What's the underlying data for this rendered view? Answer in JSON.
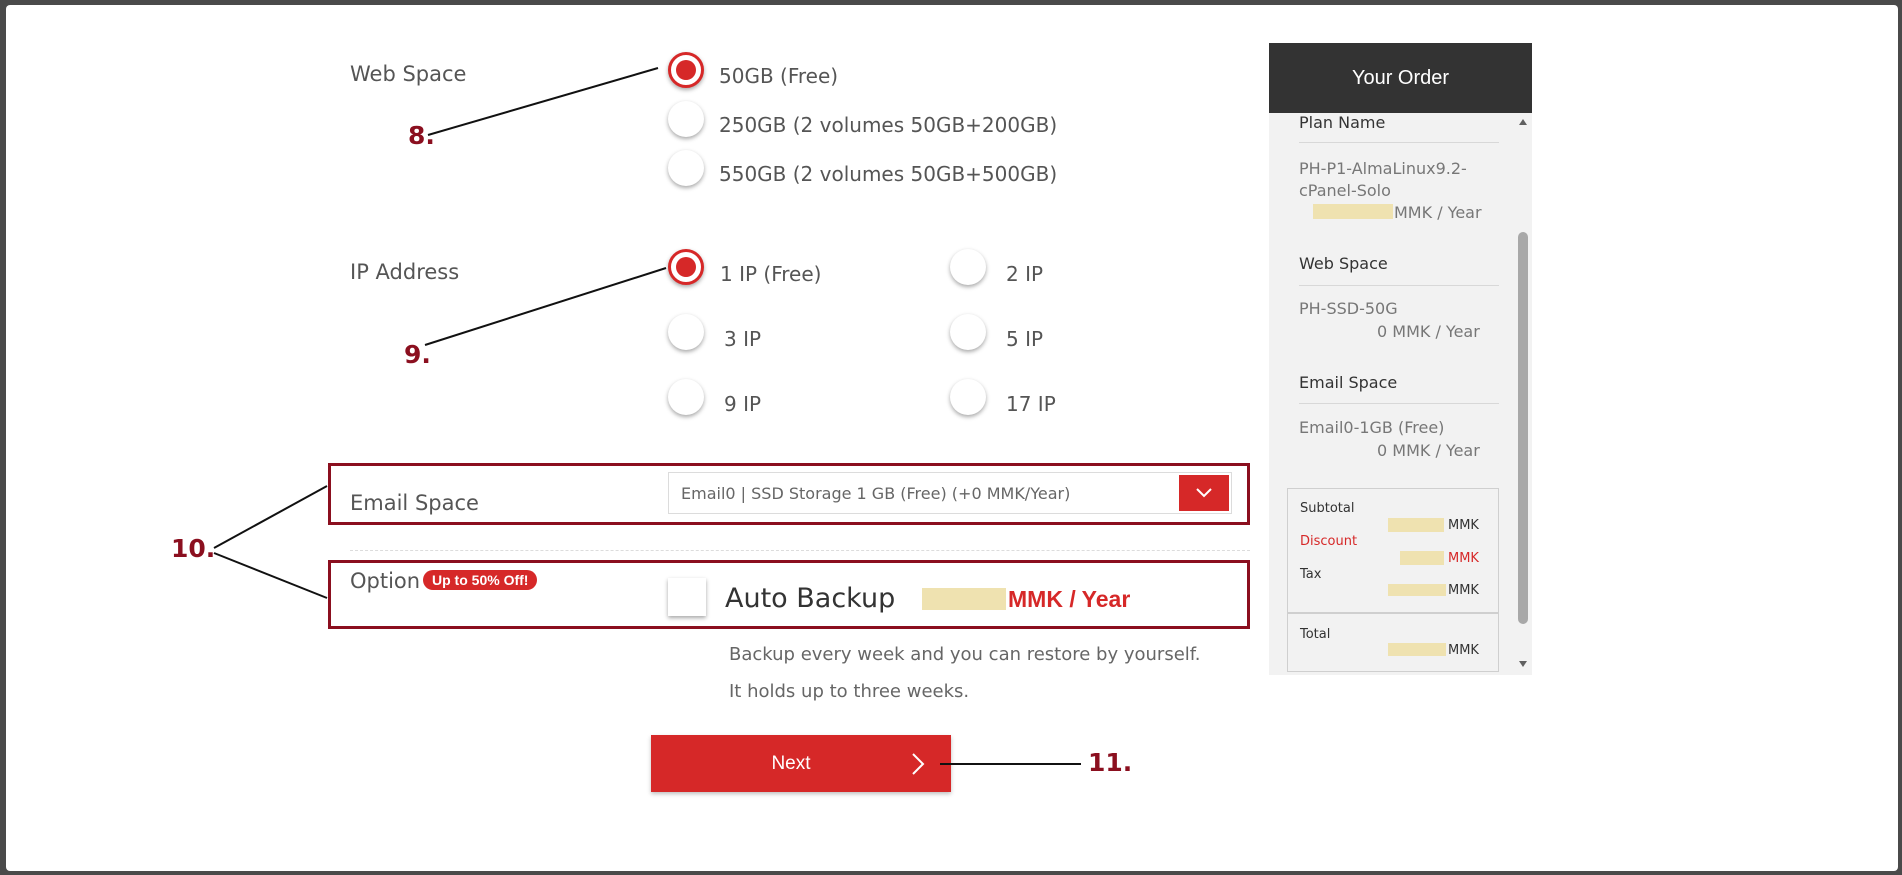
{
  "web_space": {
    "label": "Web Space",
    "options": [
      "50GB (Free)",
      "250GB (2 volumes 50GB+200GB)",
      "550GB (2 volumes 50GB+500GB)"
    ],
    "selected": "50GB (Free)"
  },
  "ip_address": {
    "label": "IP Address",
    "options": [
      "1 IP (Free)",
      "2 IP",
      "3 IP",
      "5 IP",
      "9 IP",
      "17 IP"
    ],
    "selected": "1 IP (Free)"
  },
  "email_space": {
    "label": "Email Space",
    "selected": "Email0 | SSD Storage 1 GB (Free) (+0 MMK/Year)"
  },
  "option": {
    "label": "Option",
    "badge": "Up to 50% Off!",
    "auto_backup": "Auto Backup",
    "price_suffix": "MMK / Year",
    "desc1": "Backup every week and you can restore by yourself.",
    "desc2": "It holds up to three weeks."
  },
  "next_button": {
    "label": "Next"
  },
  "annotations": [
    "8.",
    "9.",
    "10.",
    "11."
  ],
  "order": {
    "title": "Your Order",
    "plan_name_label": "Plan Name",
    "plan_name_line1": "PH-P1-AlmaLinux9.2-",
    "plan_name_line2": "cPanel-Solo",
    "plan_price": "MMK / Year",
    "web_space_label": "Web Space",
    "web_space_value": "PH-SSD-50G",
    "web_space_price": "0 MMK / Year",
    "email_space_label": "Email Space",
    "email_space_value": "Email0-1GB (Free)",
    "email_space_price": "0 MMK / Year",
    "subtotal_label": "Subtotal",
    "subtotal_value": "MMK",
    "discount_label": "Discount",
    "discount_value": "MMK",
    "tax_label": "Tax",
    "tax_value": "MMK",
    "total_label": "Total",
    "total_value": "MMK"
  },
  "colors": {
    "accent": "#d62828",
    "annotation": "#8b0f1f",
    "panel_header": "#333333"
  }
}
